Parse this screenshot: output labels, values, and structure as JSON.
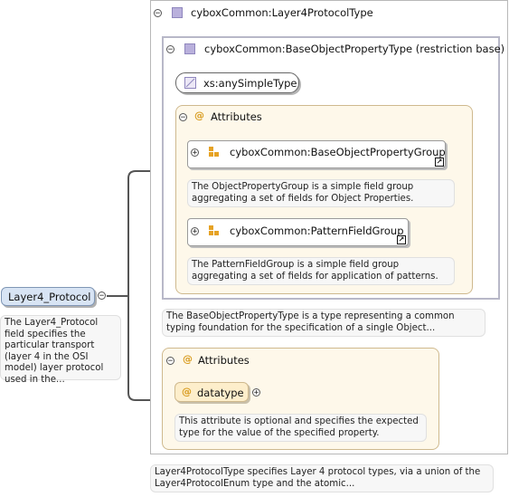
{
  "root": {
    "label": "Layer4_Protocol",
    "note": "The Layer4_Protocol field specifies the particular transport (layer 4 in the OSI model) layer protocol used in the..."
  },
  "type": {
    "title": "cyboxCommon:Layer4ProtocolType",
    "note": "Layer4ProtocolType specifies Layer 4 protocol types, via a union of the Layer4ProtocolEnum type and the atomic..."
  },
  "base": {
    "title": "cyboxCommon:BaseObjectPropertyType (restriction base)",
    "simple_type": "xs:anySimpleType",
    "note": "The BaseObjectPropertyType is a type representing a common typing foundation for the specification of a single Object...",
    "attributes_label": "Attributes",
    "groups": [
      {
        "name": "cyboxCommon:BaseObjectPropertyGroup",
        "note": "The ObjectPropertyGroup is a simple field group aggregating a set of fields for Object Properties."
      },
      {
        "name": "cyboxCommon:PatternFieldGroup",
        "note": "The PatternFieldGroup is a simple field group aggregating a set of fields for application of patterns."
      }
    ]
  },
  "attributes": {
    "label": "Attributes",
    "attribute_name": "datatype",
    "attribute_note": "This attribute is optional and specifies the expected type for the value of the specified property."
  },
  "colors": {
    "type_square": "#b9b0dc",
    "attribute_border": "#cfb98e",
    "attribute_fill": "#fef8ea",
    "root_fill": "#d8e4f4",
    "group_icon": "#e6a224"
  },
  "icons": [
    "minus-icon",
    "plus-icon",
    "type-square-icon",
    "attribute-at-icon",
    "group-icon",
    "link-arrow-icon"
  ]
}
